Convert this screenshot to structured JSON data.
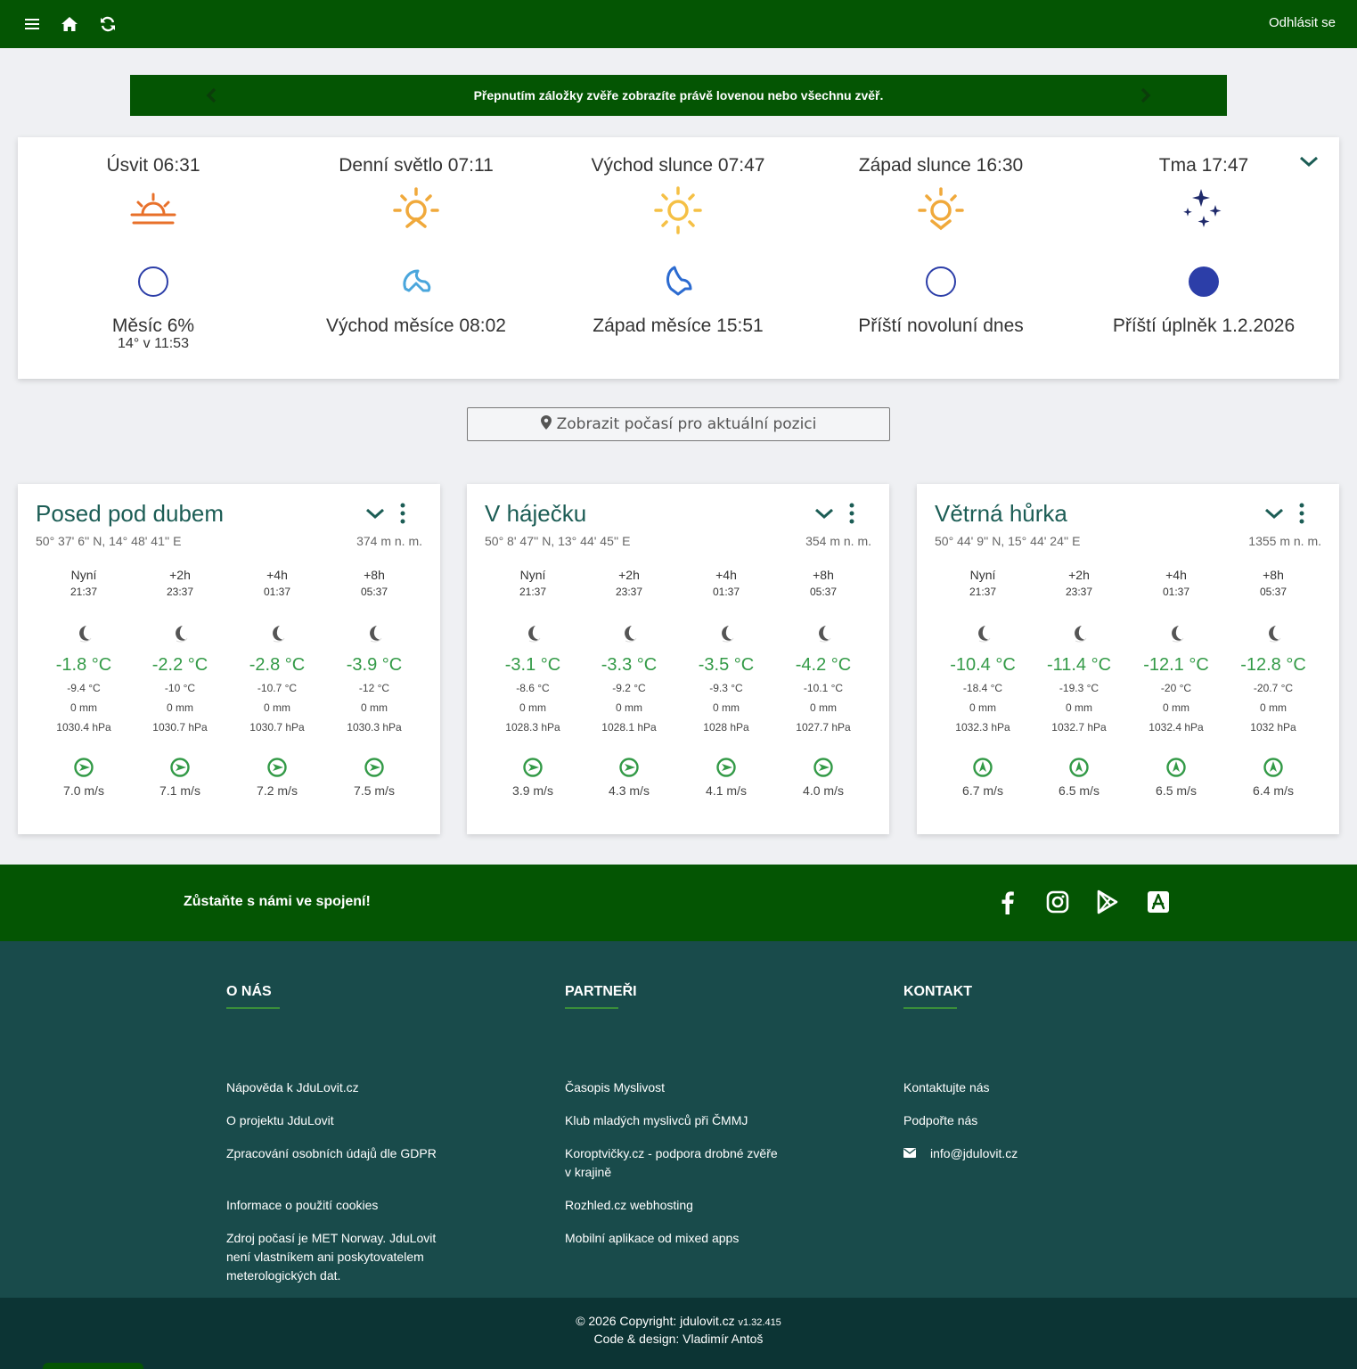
{
  "topbar": {
    "logout_label": "Odhlásit se"
  },
  "banner": {
    "text": "Přepnutím záložky zvěře zobrazíte právě lovenou nebo všechnu zvěř."
  },
  "astro": {
    "items": [
      {
        "title": "Úsvit 06:31",
        "icon": "dawn-icon",
        "moon_icon": "moon-new-outline-icon",
        "moon_title": "Měsíc 6%",
        "moon_sub": "14° v 11:53"
      },
      {
        "title": "Denní světlo 07:11",
        "icon": "sunrise-icon",
        "moon_icon": "moonrise-icon",
        "moon_title": "Východ měsíce 08:02",
        "moon_sub": ""
      },
      {
        "title": "Východ slunce 07:47",
        "icon": "sun-icon",
        "moon_icon": "moonset-icon",
        "moon_title": "Západ měsíce 15:51",
        "moon_sub": ""
      },
      {
        "title": "Západ slunce 16:30",
        "icon": "sunset-icon",
        "moon_icon": "new-moon-icon",
        "moon_title": "Příští novoluní dnes",
        "moon_sub": ""
      },
      {
        "title": "Tma 17:47",
        "icon": "stars-icon",
        "moon_icon": "full-moon-icon",
        "moon_title": "Příští úplněk 1.2.2026",
        "moon_sub": ""
      }
    ]
  },
  "location_button": {
    "label": "Zobrazit počasí pro aktuální pozici"
  },
  "stations": [
    {
      "name": "Posed pod dubem",
      "coords": "50° 37' 6'' N, 14° 48' 41'' E",
      "altitude": "374 m n. m.",
      "forecast": [
        {
          "label": "Nyní",
          "time": "21:37",
          "temp": "-1.8 °C",
          "feels": "-9.4 °C",
          "rain": "0 mm",
          "pressure": "1030.4 hPa",
          "wind": "7.0 m/s"
        },
        {
          "label": "+2h",
          "time": "23:37",
          "temp": "-2.2 °C",
          "feels": "-10 °C",
          "rain": "0 mm",
          "pressure": "1030.7 hPa",
          "wind": "7.1 m/s"
        },
        {
          "label": "+4h",
          "time": "01:37",
          "temp": "-2.8 °C",
          "feels": "-10.7 °C",
          "rain": "0 mm",
          "pressure": "1030.7 hPa",
          "wind": "7.2 m/s"
        },
        {
          "label": "+8h",
          "time": "05:37",
          "temp": "-3.9 °C",
          "feels": "-12 °C",
          "rain": "0 mm",
          "pressure": "1030.3 hPa",
          "wind": "7.5 m/s"
        }
      ]
    },
    {
      "name": "V háječku",
      "coords": "50° 8' 47'' N, 13° 44' 45'' E",
      "altitude": "354 m n. m.",
      "forecast": [
        {
          "label": "Nyní",
          "time": "21:37",
          "temp": "-3.1 °C",
          "feels": "-8.6 °C",
          "rain": "0 mm",
          "pressure": "1028.3 hPa",
          "wind": "3.9 m/s"
        },
        {
          "label": "+2h",
          "time": "23:37",
          "temp": "-3.3 °C",
          "feels": "-9.2 °C",
          "rain": "0 mm",
          "pressure": "1028.1 hPa",
          "wind": "4.3 m/s"
        },
        {
          "label": "+4h",
          "time": "01:37",
          "temp": "-3.5 °C",
          "feels": "-9.3 °C",
          "rain": "0 mm",
          "pressure": "1028 hPa",
          "wind": "4.1 m/s"
        },
        {
          "label": "+8h",
          "time": "05:37",
          "temp": "-4.2 °C",
          "feels": "-10.1 °C",
          "rain": "0 mm",
          "pressure": "1027.7 hPa",
          "wind": "4.0 m/s"
        }
      ]
    },
    {
      "name": "Větrná hůrka",
      "coords": "50° 44' 9'' N, 15° 44' 24'' E",
      "altitude": "1355 m n. m.",
      "forecast": [
        {
          "label": "Nyní",
          "time": "21:37",
          "temp": "-10.4 °C",
          "feels": "-18.4 °C",
          "rain": "0 mm",
          "pressure": "1032.3 hPa",
          "wind": "6.7 m/s"
        },
        {
          "label": "+2h",
          "time": "23:37",
          "temp": "-11.4 °C",
          "feels": "-19.3 °C",
          "rain": "0 mm",
          "pressure": "1032.7 hPa",
          "wind": "6.5 m/s"
        },
        {
          "label": "+4h",
          "time": "01:37",
          "temp": "-12.1 °C",
          "feels": "-20 °C",
          "rain": "0 mm",
          "pressure": "1032.4 hPa",
          "wind": "6.5 m/s"
        },
        {
          "label": "+8h",
          "time": "05:37",
          "temp": "-12.8 °C",
          "feels": "-20.7 °C",
          "rain": "0 mm",
          "pressure": "1032 hPa",
          "wind": "6.4 m/s"
        }
      ]
    }
  ],
  "social": {
    "text": "Zůstaňte s námi ve spojení!"
  },
  "footer": {
    "about": {
      "title": "O NÁS",
      "links": [
        "Nápověda k JduLovit.cz",
        "O projektu JduLovit",
        "Zpracování osobních údajů dle GDPR",
        "Informace o použití cookies",
        "Zdroj počasí je MET Norway. JduLovit není vlastníkem ani poskytovatelem meterologických dat."
      ]
    },
    "partners": {
      "title": "PARTNEŘI",
      "links": [
        "Časopis Myslivost",
        "Klub mladých myslivců při ČMMJ",
        "Koroptvičky.cz - podpora drobné zvěře v krajině",
        "Rozhled.cz webhosting",
        "Mobilní aplikace od mixed apps"
      ]
    },
    "contact": {
      "title": "KONTAKT",
      "links": [
        "Kontaktujte nás",
        "Podpořte nás"
      ],
      "email": "info@jdulovit.cz"
    }
  },
  "copyright": {
    "text": "© 2026 Copyright: jdulovit.cz",
    "version": "v1.32.415",
    "credit": "Code & design: Vladimír Antoš"
  },
  "colors": {
    "primary_green": "#045503",
    "temp_green": "#339a47",
    "footer_teal": "#194b4b",
    "copyright_teal": "#0c3434",
    "sun_orange": "#f0a93b",
    "dawn_orange": "#e8702a",
    "moon_blue": "#2c3ea8"
  }
}
